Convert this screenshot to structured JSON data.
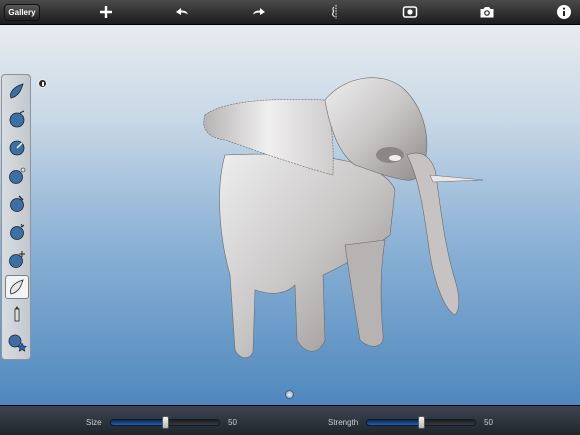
{
  "toolbar": {
    "gallery_label": "Gallery",
    "icons": [
      "add-icon",
      "undo-icon",
      "redo-icon",
      "symmetry-icon",
      "camera-reset-icon",
      "camera-icon",
      "info-icon"
    ]
  },
  "palette": {
    "tools": [
      "draw-tool",
      "inflate-tool",
      "crease-tool",
      "smooth-tool",
      "flatten-tool",
      "pinch-tool",
      "grab-tool",
      "paint-tool",
      "pencil-tool",
      "material-tool"
    ],
    "selected": "paint-tool"
  },
  "bottom": {
    "size_label": "Size",
    "size_value": "50",
    "size_level": 0.5,
    "strength_label": "Strength",
    "strength_value": "50",
    "strength_level": 0.5
  },
  "colors": {
    "accent": "#1f5fb1",
    "toolbar": "#1c1c1c"
  }
}
